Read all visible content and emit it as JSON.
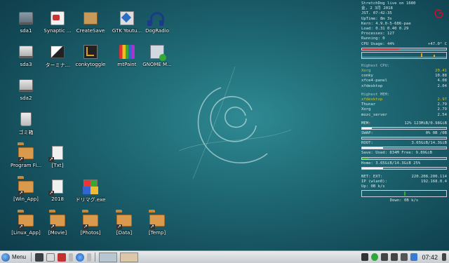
{
  "desktop": {
    "icons": [
      {
        "label": "sda1",
        "icon": "drive-icon"
      },
      {
        "label": "Synaptic ...",
        "icon": "synaptic-icon"
      },
      {
        "label": "CreateSave",
        "icon": "package-box-icon"
      },
      {
        "label": "GTK Youtu...",
        "icon": "gtk-youtube-icon"
      },
      {
        "label": "DogRadio",
        "icon": "headphones-icon"
      },
      {
        "label": "sda3",
        "icon": "drive-icon"
      },
      {
        "label": "ターミナ...",
        "icon": "terminal-icon"
      },
      {
        "label": "conkytoggle",
        "icon": "conky-icon"
      },
      {
        "label": "mtPaint",
        "icon": "paint-crayons-icon"
      },
      {
        "label": "GNOME M...",
        "icon": "gnome-mplayer-icon"
      },
      {
        "label": "sda2",
        "icon": "drive-icon"
      },
      {
        "label": "ゴミ箱",
        "icon": "trash-icon"
      },
      {
        "label": "Program Fi...",
        "icon": "folder-link-icon"
      },
      {
        "label": "[Txt]",
        "icon": "file-link-icon"
      },
      {
        "label": "[Win_App]",
        "icon": "folder-link-icon"
      },
      {
        "label": "2018",
        "icon": "file-link-icon"
      },
      {
        "label": "ドリマグ.exe",
        "icon": "exe-icon"
      },
      {
        "label": "[Linux_App]",
        "icon": "folder-link-icon"
      },
      {
        "label": "[Movie]",
        "icon": "folder-link-icon"
      },
      {
        "label": "[Photos]",
        "icon": "folder-link-icon"
      },
      {
        "label": "[Data]",
        "icon": "folder-link-icon"
      },
      {
        "label": "[Temp]",
        "icon": "folder-link-icon"
      }
    ]
  },
  "conky": {
    "title": "StretchDog live on 1680",
    "date": "金,  2 3月 2018",
    "time_line": "JST.   07:42:35",
    "uptime": "UpTime: 8m 3s",
    "kern": "Kern: 4.9.0-5-686-pae",
    "load": "Load: 0.31 0.40 0.29",
    "processes": "Processes: 127",
    "running": "Running:  0",
    "cpu_usage": "CPU Usage: 44%",
    "cpu_temp": "+47.0° C",
    "cpu_bar": 0.44,
    "top_cpu_header": "Highest CPU:",
    "top_cpu": [
      {
        "name": "Xorg",
        "value": "20.41"
      },
      {
        "name": "conky",
        "value": "10.88"
      },
      {
        "name": "xfce4-panel",
        "value": "4.08"
      },
      {
        "name": "xfdesktop",
        "value": "2.04"
      }
    ],
    "top_mem_header": "Highest MEM:",
    "top_mem": [
      {
        "name": "xfdesktop",
        "value": "2.97"
      },
      {
        "name": "Thunar",
        "value": "2.79"
      },
      {
        "name": "Xorg",
        "value": "2.79"
      },
      {
        "name": "mozc_server",
        "value": "2.54"
      }
    ],
    "mem_label": "MEM:",
    "mem_value": "12% 123MiB/0.98GiB",
    "mem_bar": 0.12,
    "swap_label": "SWAP:",
    "swap_value": "0% 0B  /0B",
    "swap_bar": 0.0,
    "root_label": "ROOT:",
    "root_value": "3.65GiB/14.3GiB",
    "root_bar": 0.25,
    "save_line": "Save: Used: 834M Free: 9.89GiB",
    "save_bar": 0.08,
    "home_line": "Home: 3.65GiB/14.3GiB 25%",
    "home_bar": 0.25,
    "net_ext": "NET: EXT:",
    "net_ext_ip": "220.208.200.114",
    "net_ip_label": "IP (wlan0):",
    "net_ip": "192.168.0.4",
    "up": "Up: 0B   k/s",
    "down": "Down: 0B   k/s"
  },
  "taskbar": {
    "menu_label": "Menu",
    "clock": "07:42"
  },
  "colors": {
    "cpu_bar": "#d02020",
    "highlight_text": "#d2c42a",
    "save_bar": "#2fb02f"
  }
}
